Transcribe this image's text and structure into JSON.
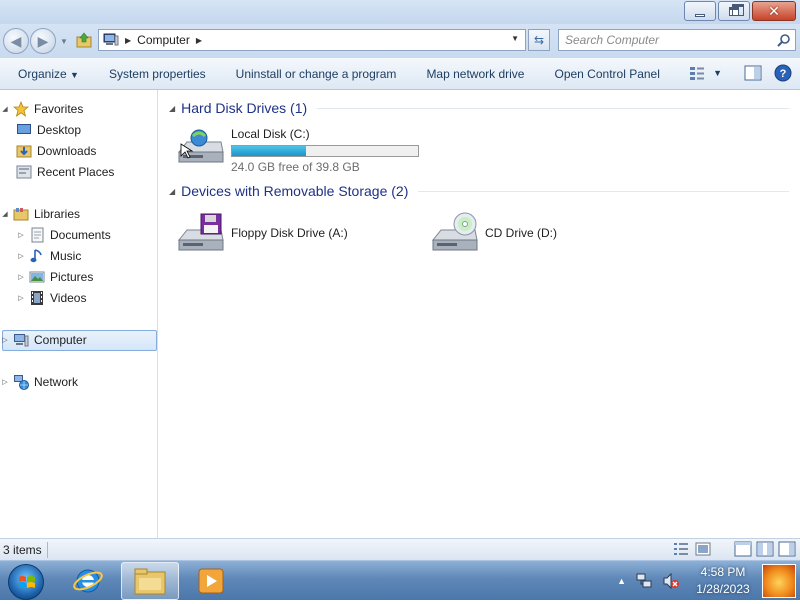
{
  "window": {
    "minimize_icon": "minimize-icon",
    "maximize_icon": "restore-icon",
    "close_icon": "close-icon"
  },
  "address": {
    "crumb": "Computer",
    "search_placeholder": "Search Computer"
  },
  "toolbar": {
    "organize": "Organize",
    "system_properties": "System properties",
    "uninstall": "Uninstall or change a program",
    "map_drive": "Map network drive",
    "control_panel": "Open Control Panel"
  },
  "navpane": {
    "favorites": "Favorites",
    "desktop": "Desktop",
    "downloads": "Downloads",
    "recent_places": "Recent Places",
    "libraries": "Libraries",
    "documents": "Documents",
    "music": "Music",
    "pictures": "Pictures",
    "videos": "Videos",
    "computer": "Computer",
    "network": "Network"
  },
  "content": {
    "hdd_group": "Hard Disk Drives (1)",
    "local_disk": {
      "name": "Local Disk (C:)",
      "free_text": "24.0 GB free of 39.8 GB",
      "used_fraction": 0.397
    },
    "removable_group": "Devices with Removable Storage (2)",
    "floppy": "Floppy Disk Drive (A:)",
    "cd": "CD Drive (D:)"
  },
  "status": {
    "count": "3 items"
  },
  "taskbar": {
    "time": "4:58 PM",
    "date": "1/28/2023"
  },
  "colors": {
    "group_title": "#1e3287",
    "disk_bar": "#1b95c8",
    "toolbar_text": "#1e3e64"
  }
}
